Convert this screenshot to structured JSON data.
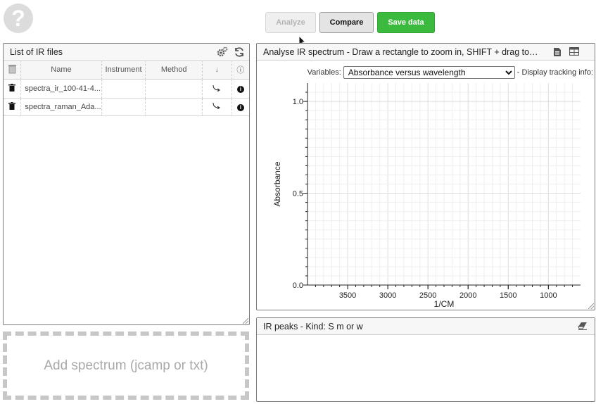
{
  "toolbar": {
    "analyze_label": "Analyze",
    "compare_label": "Compare",
    "save_label": "Save data"
  },
  "files_panel": {
    "title": "List of IR files",
    "columns": [
      "Name",
      "Instrument",
      "Method"
    ],
    "rows": [
      {
        "name": "spectra_ir_100-41-4...",
        "instrument": "",
        "method": ""
      },
      {
        "name": "spectra_raman_Ada...",
        "instrument": "",
        "method": ""
      }
    ],
    "info_glyph": "ⓘ"
  },
  "add_spectrum": {
    "label": "Add spectrum (jcamp or txt)"
  },
  "spectrum_panel": {
    "title": "Analyse IR spectrum - Draw a rectangle to zoom in, SHIFT + drag to…",
    "variables_label": "Variables:",
    "selected_variable": "Absorbance versus wavelength",
    "tracking_label": "- Display tracking info:"
  },
  "peaks_panel": {
    "title": "IR peaks - Kind: S m or w"
  },
  "chart_data": {
    "type": "line",
    "xlabel": "1/CM",
    "ylabel": "Absorbance",
    "x_ticks": [
      3500,
      3000,
      2500,
      2000,
      1500,
      1000
    ],
    "y_ticks": [
      0.0,
      0.5,
      1.0
    ],
    "x_tick_labels": [
      "3500",
      "3000",
      "2500",
      "2000",
      "1500",
      "1000"
    ],
    "y_tick_labels": [
      "0.0",
      "0.5",
      "1.0"
    ],
    "xlim": [
      4000,
      600
    ],
    "ylim": [
      0,
      1.1
    ],
    "x_reversed": true,
    "grid": true,
    "series": []
  }
}
